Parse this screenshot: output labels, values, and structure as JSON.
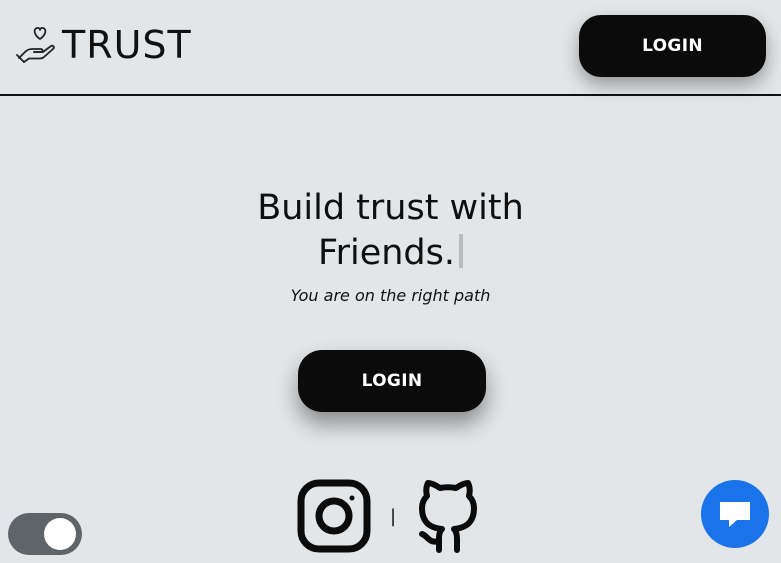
{
  "header": {
    "brand_text": "TRUST",
    "brand_icon": "heart-hand-icon",
    "login_label": "LOGIN"
  },
  "hero": {
    "title_line1": "Build trust with",
    "title_line2": "Friends.",
    "subtitle": "You are on the right path",
    "login_label": "LOGIN"
  },
  "socials": {
    "items": [
      {
        "icon": "instagram-icon"
      },
      {
        "icon": "github-icon"
      }
    ],
    "separator": "|"
  },
  "theme_toggle": {
    "icon": "toggle-switch",
    "state": "on"
  },
  "chat": {
    "icon": "chat-bubble-icon"
  },
  "colors": {
    "background": "#e3e6e8",
    "button": "#0b0b0b",
    "button_text": "#ffffff",
    "toggle": "#5f6468",
    "chat": "#1a73e8"
  }
}
